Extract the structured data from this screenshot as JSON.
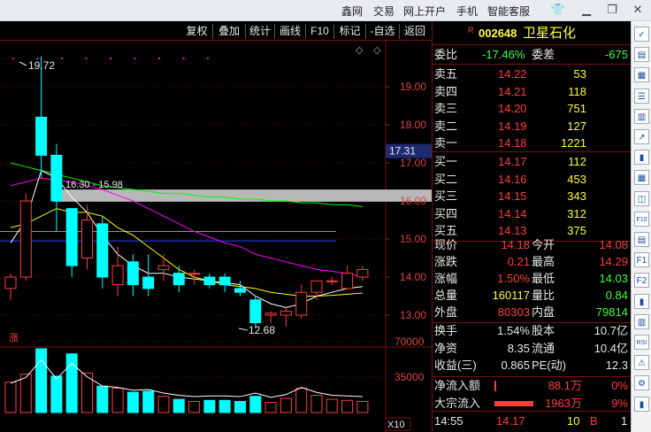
{
  "topbar": {
    "links": [
      "鑫网",
      "交易",
      "网上开户",
      "手机",
      "智能客服"
    ],
    "controls": [
      "shirt-icon",
      "minimize-icon",
      "restore-icon",
      "close-icon"
    ]
  },
  "toolbar": {
    "buttons": [
      "复权",
      "叠加",
      "统计",
      "画线",
      "F10",
      "标记",
      "-自选",
      "返回"
    ],
    "diamond_icons": [
      "diamond-icon",
      "diamond-icon"
    ]
  },
  "chart": {
    "price_axis": [
      "19.00",
      "18.00",
      "17.00",
      "16.00",
      "15.00",
      "14.00",
      "13.00"
    ],
    "current_price_tag": "17.31",
    "high_label": "19.72",
    "low_label": "12.68",
    "band_label": "16.30 - 15.98",
    "marker_label": "涨",
    "volume_axis": [
      "70000",
      "35000"
    ],
    "volume_unit": "X10",
    "colors": {
      "up": "#ff3c3c",
      "down": "#00ffff",
      "ma5": "#ffffff",
      "ma10": "#ffff00",
      "ma20": "#ff00ff",
      "ma60": "#00ff00"
    }
  },
  "chart_data": {
    "type": "candlestick",
    "title": "",
    "ylim": [
      12.5,
      20.0
    ],
    "candles": [
      {
        "o": 13.7,
        "h": 14.1,
        "l": 13.4,
        "c": 14.0
      },
      {
        "o": 14.0,
        "h": 16.2,
        "l": 13.9,
        "c": 16.0
      },
      {
        "o": 18.2,
        "h": 19.8,
        "l": 16.6,
        "c": 17.2
      },
      {
        "o": 17.2,
        "h": 17.5,
        "l": 15.2,
        "c": 16.0
      },
      {
        "o": 15.8,
        "h": 15.8,
        "l": 14.0,
        "c": 14.3
      },
      {
        "o": 14.5,
        "h": 15.9,
        "l": 14.2,
        "c": 15.5
      },
      {
        "o": 15.4,
        "h": 15.6,
        "l": 13.7,
        "c": 14.0
      },
      {
        "o": 13.8,
        "h": 14.8,
        "l": 13.5,
        "c": 14.3
      },
      {
        "o": 14.4,
        "h": 14.6,
        "l": 13.5,
        "c": 13.8
      },
      {
        "o": 14.0,
        "h": 14.6,
        "l": 13.5,
        "c": 13.7
      },
      {
        "o": 14.2,
        "h": 14.6,
        "l": 13.9,
        "c": 14.3
      },
      {
        "o": 14.1,
        "h": 14.3,
        "l": 13.6,
        "c": 13.8
      },
      {
        "o": 14.1,
        "h": 14.2,
        "l": 13.8,
        "c": 14.1
      },
      {
        "o": 14.0,
        "h": 14.1,
        "l": 13.7,
        "c": 13.8
      },
      {
        "o": 14.0,
        "h": 14.1,
        "l": 13.6,
        "c": 13.8
      },
      {
        "o": 13.7,
        "h": 13.9,
        "l": 13.5,
        "c": 13.6
      },
      {
        "o": 13.4,
        "h": 13.5,
        "l": 12.68,
        "c": 12.8
      },
      {
        "o": 13.0,
        "h": 13.1,
        "l": 12.8,
        "c": 13.05
      },
      {
        "o": 13.0,
        "h": 13.2,
        "l": 12.7,
        "c": 13.1
      },
      {
        "o": 13.0,
        "h": 13.8,
        "l": 12.9,
        "c": 13.6
      },
      {
        "o": 13.6,
        "h": 13.9,
        "l": 13.4,
        "c": 13.9
      },
      {
        "o": 13.9,
        "h": 14.0,
        "l": 13.8,
        "c": 13.9
      },
      {
        "o": 13.7,
        "h": 14.3,
        "l": 13.7,
        "c": 14.1
      },
      {
        "o": 14.0,
        "h": 14.3,
        "l": 13.9,
        "c": 14.2
      }
    ],
    "volumes": [
      30000,
      38000,
      63000,
      36000,
      58000,
      39000,
      26000,
      24000,
      20000,
      21000,
      16000,
      13000,
      11000,
      12000,
      12000,
      11000,
      16000,
      10000,
      14000,
      24000,
      17000,
      13000,
      12000,
      11000
    ],
    "ma5": [
      14.9,
      15.5,
      16.8,
      16.6,
      16.1,
      15.7,
      15.1,
      14.6,
      14.3,
      14.1,
      14.1,
      14.0,
      13.95,
      13.9,
      13.85,
      13.8,
      13.5,
      13.3,
      13.2,
      13.3,
      13.5,
      13.6,
      13.7,
      13.75
    ],
    "ma10": [
      15.3,
      15.4,
      15.6,
      15.8,
      15.7,
      15.7,
      15.6,
      15.3,
      15.1,
      14.8,
      14.5,
      14.2,
      14.0,
      13.9,
      13.8,
      13.75,
      13.7,
      13.6,
      13.55,
      13.5,
      13.5,
      13.52,
      13.55,
      13.58
    ],
    "ma20": [
      16.4,
      16.5,
      16.6,
      16.55,
      16.5,
      16.4,
      16.3,
      16.15,
      16.0,
      15.8,
      15.6,
      15.4,
      15.2,
      15.05,
      14.9,
      14.8,
      14.6,
      14.5,
      14.4,
      14.3,
      14.2,
      14.15,
      14.1,
      14.0
    ],
    "ma60": [
      17.0,
      16.9,
      16.8,
      16.7,
      16.6,
      16.5,
      16.4,
      16.35,
      16.3,
      16.25,
      16.2,
      16.2,
      16.15,
      16.1,
      16.1,
      16.05,
      16.05,
      16.0,
      16.0,
      15.95,
      15.95,
      15.9,
      15.9,
      15.85
    ]
  },
  "quote": {
    "r_badge": "R",
    "code": "002648",
    "name": "卫星石化",
    "weibi_label": "委比",
    "weibi": "-17.46%",
    "weicha_label": "委差",
    "weicha": "-675",
    "asks": [
      {
        "label": "卖五",
        "price": "14.22",
        "vol": "53"
      },
      {
        "label": "卖四",
        "price": "14.21",
        "vol": "118"
      },
      {
        "label": "卖三",
        "price": "14.20",
        "vol": "751"
      },
      {
        "label": "卖二",
        "price": "14.19",
        "vol": "127"
      },
      {
        "label": "卖一",
        "price": "14.18",
        "vol": "1221"
      }
    ],
    "bids": [
      {
        "label": "买一",
        "price": "14.17",
        "vol": "112"
      },
      {
        "label": "买二",
        "price": "14.16",
        "vol": "453"
      },
      {
        "label": "买三",
        "price": "14.15",
        "vol": "343"
      },
      {
        "label": "买四",
        "price": "14.14",
        "vol": "312"
      },
      {
        "label": "买五",
        "price": "14.13",
        "vol": "375"
      }
    ],
    "stats": [
      {
        "l1": "现价",
        "v1": "14.18",
        "c1": "red",
        "l2": "今开",
        "v2": "14.08",
        "c2": "red"
      },
      {
        "l1": "涨跌",
        "v1": "0.21",
        "c1": "red",
        "l2": "最高",
        "v2": "14.29",
        "c2": "red"
      },
      {
        "l1": "涨幅",
        "v1": "1.50%",
        "c1": "red",
        "l2": "最低",
        "v2": "14.03",
        "c2": "green"
      },
      {
        "l1": "总量",
        "v1": "160117",
        "c1": "yellow",
        "l2": "量比",
        "v2": "0.84",
        "c2": "green"
      },
      {
        "l1": "外盘",
        "v1": "80303",
        "c1": "red",
        "l2": "内盘",
        "v2": "79814",
        "c2": "green"
      }
    ],
    "stats2": [
      {
        "l1": "换手",
        "v1": "1.54%",
        "l2": "股本",
        "v2": "10.7亿"
      },
      {
        "l1": "净资",
        "v1": "8.35",
        "l2": "流通",
        "v2": "10.4亿"
      },
      {
        "l1": "收益(三)",
        "v1": "0.865",
        "l2": "PE(动)",
        "v2": "12.3"
      }
    ],
    "flow": [
      {
        "label": "净流入额",
        "value": "88.1万",
        "pct": "0%"
      },
      {
        "label": "大宗流入",
        "value": "1963万",
        "pct": "9%"
      }
    ],
    "tick": {
      "time": "14:55",
      "price": "14.17",
      "vol": "10",
      "side": "B",
      "count": "1"
    }
  },
  "side_tools": [
    "pin-icon",
    "chart-icon",
    "table-icon",
    "list-icon",
    "report-icon",
    "trend-icon",
    "candle-icon",
    "grid-icon",
    "tile-icon",
    "f10-icon",
    "doc-icon",
    "f1-icon",
    "f2-icon",
    "kline-icon",
    "bars-icon",
    "rsi-icon",
    "alert-icon",
    "settings-icon",
    "volume-icon"
  ],
  "side_tool_labels": [
    "✓",
    "▤",
    "▦",
    "☰",
    "▥",
    "↗",
    "▮",
    "▦",
    "◫",
    "F10",
    "▤",
    "F1",
    "F2",
    "▮",
    "▥",
    "RSI",
    "⚠",
    "⚙",
    "▮"
  ]
}
